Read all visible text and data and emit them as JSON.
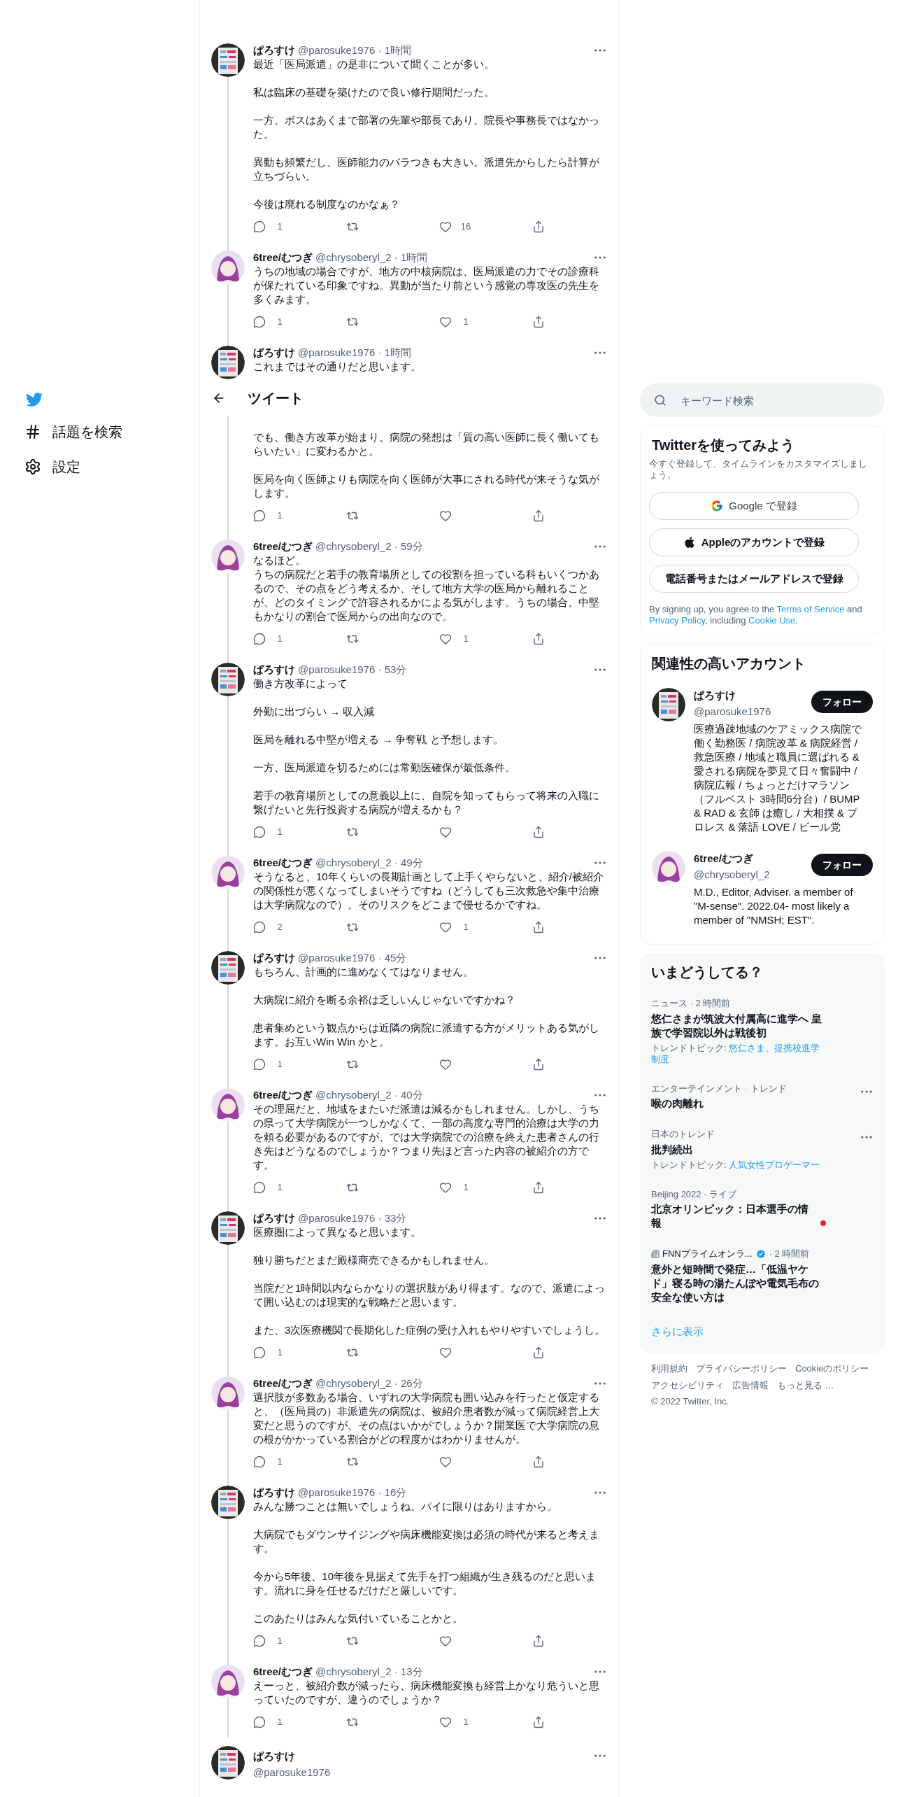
{
  "nav": [
    {
      "kind": "logo"
    },
    {
      "kind": "explore",
      "label": "話題を検索"
    },
    {
      "kind": "settings",
      "label": "設定"
    }
  ],
  "header": {
    "title": "ツイート"
  },
  "tweets": [
    {
      "name": "ぱろすけ",
      "meta": "@parosuke1976 · 1時間",
      "paragraphs": [
        [
          "最近「医局派遣」の是非について聞くことが多い。"
        ],
        [
          "私は臨床の基礎を築けたので良い修行期間だった。"
        ],
        [
          "一方、ボスはあくまで部署の先輩や部長であり、院長や事務長ではなかった。"
        ],
        [
          "異動も頻繁だし、医師能力のバラつきも大きい。派遣先からしたら計算が立ちづらい。"
        ],
        [
          "今後は廃れる制度なのかなぁ？"
        ]
      ],
      "replies": "1",
      "likes": "16"
    },
    {
      "kind": "figure",
      "name": "6tree/むつぎ",
      "meta": "@chrysoberyl_2 · 1時間",
      "paragraphs": [
        [
          "うちの地域の場合ですが、地方の中核病院は、医局派遣の力でその診療科が保たれている印象ですね。異動が当たり前という感覚の専攻医の先生を多くみます。"
        ]
      ],
      "replies": "1",
      "likes": "1"
    },
    {
      "name": "ぱろすけ",
      "meta": "@parosuke1976 · 1時間",
      "paragraphs": [
        [
          "これまではその通りだと思います。"
        ]
      ],
      "continued_paragraphs": [
        [
          "でも、働き方改革が始まり、病院の発想は「質の高い医師に長く働いてもらいたい」に変わるかと。"
        ],
        [
          "医局を向く医師よりも病院を向く医師が大事にされる時代が来そうな気がします。"
        ]
      ],
      "replies": "1"
    },
    {
      "kind": "figure",
      "name": "6tree/むつぎ",
      "meta": "@chrysoberyl_2 · 59分",
      "paragraphs": [
        [
          "なるほど。",
          "うちの病院だと若手の教育場所としての役割を担っている科もいくつかあるので、その点をどう考えるか、そして地方大学の医局から離れることが、どのタイミングで許容されるかによる気がします。うちの場合、中堅もかなりの割合で医局からの出向なので。"
        ]
      ],
      "replies": "1",
      "likes": "1"
    },
    {
      "name": "ぱろすけ",
      "meta": "@parosuke1976 · 53分",
      "paragraphs": [
        [
          "働き方改革によって"
        ],
        [
          "外勤に出づらい → 収入減"
        ],
        [
          "医局を離れる中堅が増える → 争奪戦 と予想します。"
        ],
        [
          "一方、医局派遣を切るためには常勤医確保が最低条件。"
        ],
        [
          "若手の教育場所としての意義以上に、自院を知ってもらって将来の入職に繋げたいと先行投資する病院が増えるかも？"
        ]
      ],
      "replies": "1"
    },
    {
      "kind": "figure",
      "name": "6tree/むつぎ",
      "meta": "@chrysoberyl_2 · 49分",
      "paragraphs": [
        [
          "そうなると、10年くらいの長期計画として上手くやらないと、紹介/被紹介の関係性が悪くなってしまいそうですね（どうしても三次救急や集中治療は大学病院なので）。そのリスクをどこまで侵せるかですね。"
        ]
      ],
      "replies": "2",
      "likes": "1"
    },
    {
      "name": "ぱろすけ",
      "meta": "@parosuke1976 · 45分",
      "paragraphs": [
        [
          "もちろん、計画的に進めなくてはなりません。"
        ],
        [
          "大病院に紹介を断る余裕は乏しいんじゃないですかね？"
        ],
        [
          "患者集めという観点からは近隣の病院に派遣する方がメリットある気がします。お互いWin Win かと。"
        ]
      ],
      "replies": "1"
    },
    {
      "kind": "figure",
      "name": "6tree/むつぎ",
      "meta": "@chrysoberyl_2 · 40分",
      "paragraphs": [
        [
          "その理屈だと、地域をまたいだ派遣は減るかもしれません。しかし、うちの県って大学病院が一つしかなくて、一部の高度な専門的治療は大学の力を頼る必要があるのですが、では大学病院での治療を終えた患者さんの行き先はどうなるのでしょうか？つまり先ほど言った内容の被紹介の方です。"
        ]
      ],
      "replies": "1",
      "likes": "1"
    },
    {
      "name": "ぱろすけ",
      "meta": "@parosuke1976 · 33分",
      "paragraphs": [
        [
          "医療圏によって異なると思います。"
        ],
        [
          "独り勝ちだとまだ殿様商売できるかもしれません。"
        ],
        [
          "当院だと1時間以内ならかなりの選択肢があり得ます。なので、派遣によって囲い込むのは現実的な戦略だと思います。"
        ],
        [
          "また、3次医療機関で長期化した症例の受け入れもやりやすいでしょうし。"
        ]
      ],
      "replies": "1"
    },
    {
      "kind": "figure",
      "name": "6tree/むつぎ",
      "meta": "@chrysoberyl_2 · 26分",
      "paragraphs": [
        [
          "選択肢が多数ある場合、いずれの大学病院も囲い込みを行ったと仮定すると、（医局員の）非派遣先の病院は、被紹介患者数が減って病院経営上大変だと思うのですが、その点はいかがでしょうか？開業医で大学病院の息の根がかかっている割合がどの程度かはわかりませんが。"
        ]
      ],
      "replies": "1"
    },
    {
      "name": "ぱろすけ",
      "meta": "@parosuke1976 · 16分",
      "paragraphs": [
        [
          "みんな勝つことは無いでしょうね。パイに限りはありますから。"
        ],
        [
          "大病院でもダウンサイジングや病床機能変換は必須の時代が来ると考えます。"
        ],
        [
          "今から5年後、10年後を見据えて先手を打つ組織が生き残るのだと思います。流れに身を任せるだけだと厳しいです。"
        ],
        [
          "このあたりはみんな気付いていることかと。"
        ]
      ],
      "replies": "1"
    },
    {
      "kind": "figure",
      "name": "6tree/むつぎ",
      "meta": "@chrysoberyl_2 · 13分",
      "paragraphs": [
        [
          "えーっと、被紹介数が減ったら、病床機能変換も経営上かなり危ういと思っていたのですが、違うのでしょうか？"
        ]
      ],
      "replies": "1",
      "likes": "1"
    }
  ],
  "focused_tweet": {
    "name": "ぱろすけ",
    "handle": "@parosuke1976"
  },
  "search": {
    "placeholder": "キーワード検索"
  },
  "signup": {
    "title": "Twitterを使ってみよう",
    "subtitle": "今すぐ登録して、タイムラインをカスタマイズしましょう。",
    "buttons": [
      {
        "kind": "google",
        "label": "Google で登録"
      },
      {
        "kind": "apple",
        "label": "Appleのアカウントで登録"
      },
      {
        "kind": "phone",
        "label": "電話番号またはメールアドレスで登録"
      }
    ],
    "legal": [
      {
        "kind": "plain",
        "text": "By signing up, you agree to the "
      },
      {
        "kind": "link",
        "text": "Terms of Service"
      },
      {
        "kind": "plain",
        "text": " and "
      },
      {
        "kind": "link",
        "text": "Privacy Policy"
      },
      {
        "kind": "plain",
        "text": ", including "
      },
      {
        "kind": "link",
        "text": "Cookie Use"
      },
      {
        "kind": "plain",
        "text": "."
      }
    ]
  },
  "accounts": {
    "title": "関連性の高いアカウント",
    "items": [
      {
        "name": "ぱろすけ",
        "handle": "@parosuke1976",
        "bio": "医療過疎地域のケアミックス病院で働く勤務医 / 病院改革 & 病院経営 / 救急医療 / 地域と職員に選ばれる & 愛される病院を夢見て日々奮闘中 / 病院広報 / ちょっとだけマラソン（フルベスト 3時間6分台）/ BUMP & RAD & 玄師 は癒し / 大相撲 & プロレス & 落語 LOVE / ビール党",
        "follow": "フォロー"
      },
      {
        "kind": "figure",
        "name": "6tree/むつぎ",
        "handle": "@chrysoberyl_2",
        "bio": "M.D., Editor, Adviser. a member of \"M-sense\". 2022.04- most likely a member of \"NMSH; EST\".",
        "follow": "フォロー"
      }
    ]
  },
  "trends": {
    "title": "いまどうしてる？",
    "items": [
      {
        "kind": "news",
        "meta": "ニュース · 2 時間前",
        "title": "悠仁さまが筑波大付属高に進学へ 皇族で学習院以外は戦後初",
        "topic_label": "トレンドトピック: ",
        "topic": "悠仁さま、提携校進学制度"
      },
      {
        "kind": "trend",
        "meta": "エンターテインメント · トレンド",
        "title": "喉の肉離れ"
      },
      {
        "kind": "trend",
        "meta": "日本のトレンド",
        "title": "批判続出",
        "topic_label": "トレンドトピック: ",
        "topic": "人気女性プロゲーマー"
      },
      {
        "kind": "live",
        "meta": "Beijing 2022 · ライブ",
        "title": "北京オリンピック：日本選手の情報"
      },
      {
        "kind": "article",
        "source": "FNNプライムオンラ...",
        "meta": "· 2 時間前",
        "title": "意外と短時間で発症…「低温ヤケド」寝る時の湯たんぽや電気毛布の安全な使い方は"
      }
    ],
    "more": "さらに表示"
  },
  "footer": [
    "利用規約",
    "プライバシーポリシー",
    "Cookieのポリシー",
    "アクセシビリティ",
    "広告情報",
    "もっと見る …"
  ],
  "copyright": "© 2022 Twitter, Inc."
}
